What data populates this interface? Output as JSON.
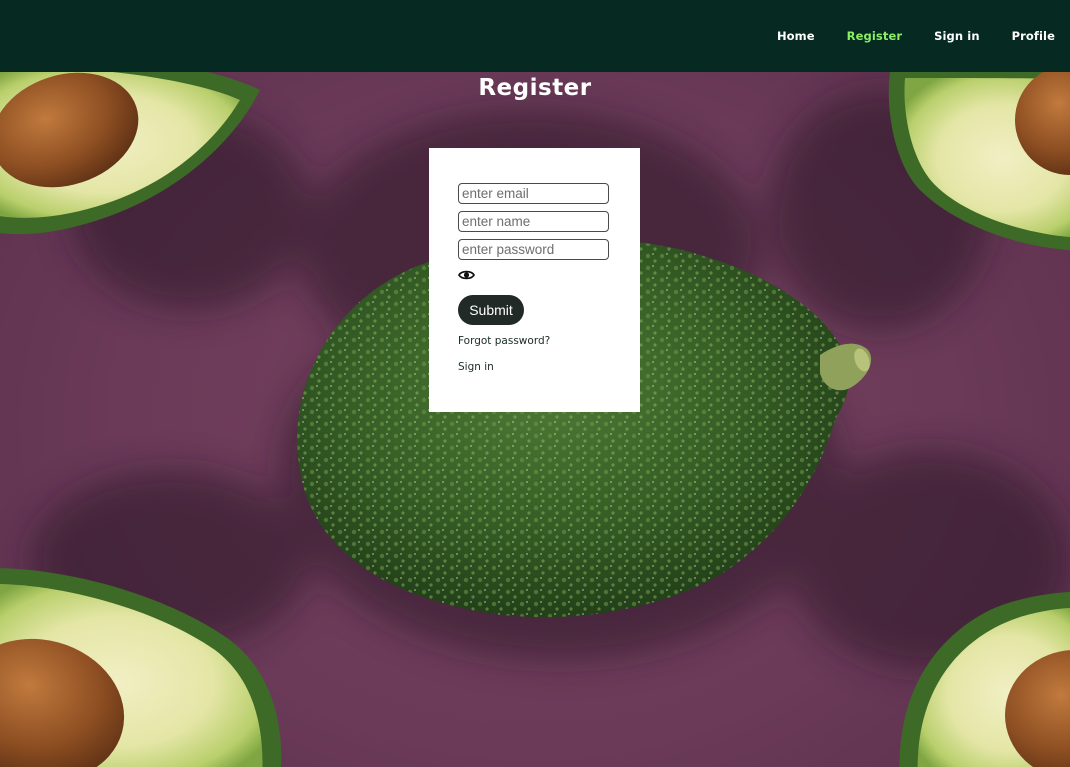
{
  "nav": {
    "items": [
      {
        "label": "Home",
        "active": false
      },
      {
        "label": "Register",
        "active": true
      },
      {
        "label": "Sign in",
        "active": false
      },
      {
        "label": "Profile",
        "active": false
      }
    ],
    "active_color": "#8aef63",
    "background_color": "#062a22"
  },
  "page": {
    "title": "Register",
    "background_color": "#6b3b5a"
  },
  "form": {
    "email": {
      "placeholder": "enter email",
      "value": ""
    },
    "name": {
      "placeholder": "enter name",
      "value": ""
    },
    "password": {
      "placeholder": "enter password",
      "value": ""
    },
    "toggle_icon": "eye-icon",
    "submit_label": "Submit",
    "forgot_label": "Forgot password?",
    "signin_label": "Sign in"
  }
}
